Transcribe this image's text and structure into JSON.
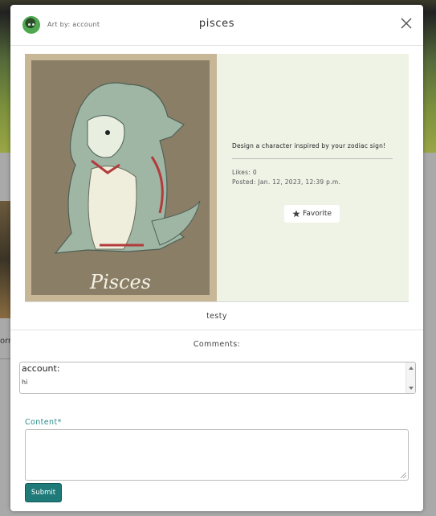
{
  "background": {
    "visible_word": "orn"
  },
  "modal": {
    "credit": "Art by: account",
    "title": "pisces",
    "close_icon": "close-icon"
  },
  "artwork": {
    "label": "Pisces"
  },
  "info": {
    "prompt": "Design a character inspired by your zodiac sign!",
    "likes": "Likes: 0",
    "posted": "Posted: Jan. 12, 2023, 12:39 p.m.",
    "favorite_label": "Favorite",
    "favorite_icon": "star-icon"
  },
  "caption": "testy",
  "comments": {
    "heading": "Comments:",
    "items": [
      {
        "author": "account:",
        "text": "hi"
      }
    ]
  },
  "form": {
    "content_label": "Content*",
    "submit_label": "Submit"
  },
  "colors": {
    "accent": "#1f7a7a",
    "label_teal": "#2a8a8a",
    "info_panel": "#eef3e6"
  }
}
